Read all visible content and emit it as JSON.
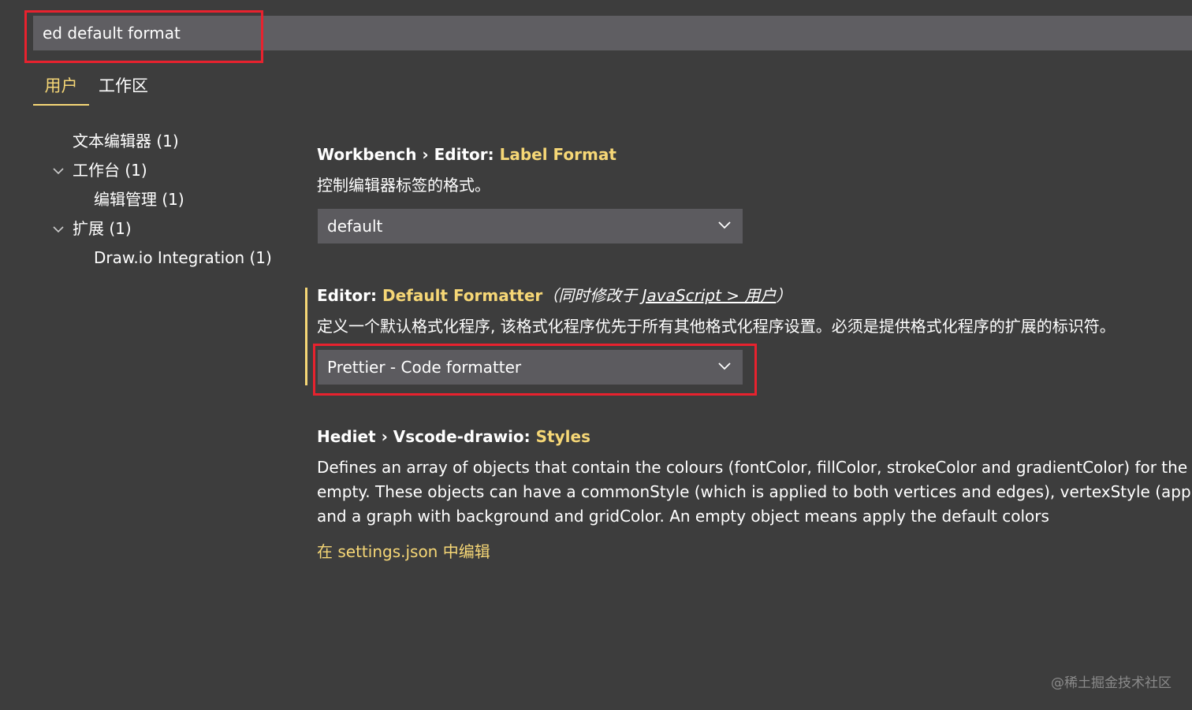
{
  "search": {
    "value": "ed default format"
  },
  "tabs": [
    {
      "label": "用户"
    },
    {
      "label": "工作区"
    }
  ],
  "tree": [
    {
      "label": "文本编辑器 (1)"
    },
    {
      "label": "工作台 (1)"
    },
    {
      "label": "编辑管理 (1)"
    },
    {
      "label": "扩展 (1)"
    },
    {
      "label": "Draw.io Integration (1)"
    }
  ],
  "settings": [
    {
      "prefix": "Workbench › Editor: ",
      "key": "Label Format",
      "description": "控制编辑器标签的格式。",
      "value": "default"
    },
    {
      "prefix": "Editor: ",
      "key": "Default Formatter",
      "modified_open": "（同时修改于 ",
      "modified_link": "JavaScript > 用户",
      "modified_close": "）",
      "description": "定义一个默认格式化程序, 该格式化程序优先于所有其他格式化程序设置。必须是提供格式化程序的扩展的标识符。",
      "value": "Prettier - Code formatter"
    },
    {
      "prefix": "Hediet › Vscode-drawio: ",
      "key": "Styles",
      "description_lines": [
        "Defines an array of objects that contain the colours (fontColor, fillColor, strokeColor and gradientColor) for the Style",
        "empty. These objects can have a commonStyle (which is applied to both vertices and edges), vertexStyle (applied to",
        "and a graph with background and gridColor. An empty object means apply the default colors"
      ],
      "edit_link": "在 settings.json 中编辑"
    }
  ],
  "watermark": "@稀土掘金技术社区",
  "colors": {
    "background": "#3d3d3d",
    "search_bg": "#5f5e62",
    "accent": "#f6d776",
    "highlight_box": "#e8222e"
  }
}
